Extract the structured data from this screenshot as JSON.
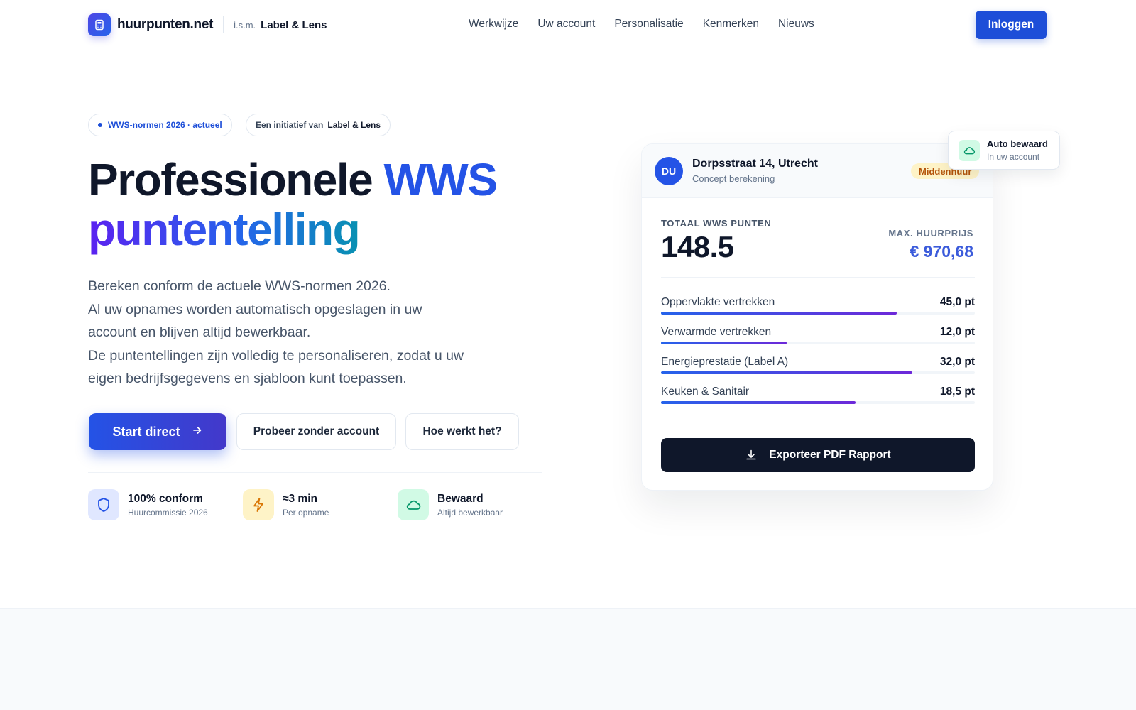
{
  "nav": {
    "brand": "huurpunten.net",
    "ism": "i.s.m.",
    "partner": "Label & Lens",
    "menu": [
      "Werkwijze",
      "Uw account",
      "Personalisatie",
      "Kenmerken",
      "Nieuws"
    ],
    "login_label": "Inloggen"
  },
  "badges": {
    "norms": "WWS-normen 2026 · actueel",
    "initiative_prefix": "Een initiatief van",
    "initiative_name": "Label & Lens"
  },
  "hero": {
    "title_part1": "Professionele ",
    "title_accent": "WWS",
    "title_line2": "puntentelling",
    "desc_lines": [
      "Bereken conform de actuele WWS-normen 2026.",
      "Al uw opnames worden automatisch opgeslagen in uw",
      "account en blijven altijd bewerkbaar.",
      "De puntentellingen zijn volledig te personaliseren, zodat u uw",
      "eigen bedrijfsgegevens en sjabloon kunt toepassen."
    ],
    "cta_primary": "Start direct",
    "cta_secondary": "Probeer zonder account",
    "cta_tertiary": "Hoe werkt het?"
  },
  "features": [
    {
      "title": "100% conform",
      "subtitle": "Huurcommissie 2026",
      "icon": "shield-icon"
    },
    {
      "title": "≈3 min",
      "subtitle": "Per opname",
      "icon": "lightning-icon"
    },
    {
      "title": "Bewaard",
      "subtitle": "Altijd bewerkbaar",
      "icon": "cloud-icon"
    }
  ],
  "card": {
    "avatar": "DU",
    "address": "Dorpsstraat 14, Utrecht",
    "status": "Concept berekening",
    "segment": "Middenhuur",
    "total_label": "TOTAAL WWS PUNTEN",
    "total_value": "148.5",
    "max_label": "MAX. HUURPRIJS",
    "max_value": "€ 970,68",
    "rows": [
      {
        "name": "Oppervlakte vertrekken",
        "value": "45,0 pt",
        "fill": 0.75
      },
      {
        "name": "Verwarmde vertrekken",
        "value": "12,0 pt",
        "fill": 0.4
      },
      {
        "name": "Energieprestatie (Label A)",
        "value": "32,0 pt",
        "fill": 0.8
      },
      {
        "name": "Keuken & Sanitair",
        "value": "18,5 pt",
        "fill": 0.62
      }
    ],
    "export_label": "Exporteer PDF Rapport"
  },
  "float_badge": {
    "title": "Auto bewaard",
    "subtitle": "In uw account"
  },
  "colors": {
    "brand_blue": "#1d4ed8",
    "accent": "#2453e6",
    "dark": "#0f172a",
    "segment_bg": "#fef3c7"
  }
}
